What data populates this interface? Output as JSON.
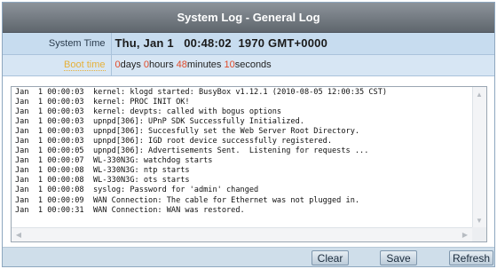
{
  "window": {
    "title": "System Log - General Log"
  },
  "system_time": {
    "label": "System Time",
    "value": "Thu, Jan 1   00:48:02  1970 GMT+0000"
  },
  "boot_time": {
    "label": "Boot time",
    "days": "0",
    "days_unit": "days ",
    "hours": "0",
    "hours_unit": "hours ",
    "minutes": "48",
    "minutes_unit": "minutes ",
    "seconds": "10",
    "seconds_unit": "seconds"
  },
  "log": {
    "lines": [
      "Jan  1 00:00:03  kernel: klogd started: BusyBox v1.12.1 (2010-08-05 12:00:35 CST)",
      "Jan  1 00:00:03  kernel: PROC INIT OK!",
      "Jan  1 00:00:03  kernel: devpts: called with bogus options",
      "Jan  1 00:00:03  upnpd[306]: UPnP SDK Successfully Initialized.",
      "Jan  1 00:00:03  upnpd[306]: Succesfully set the Web Server Root Directory.",
      "Jan  1 00:00:03  upnpd[306]: IGD root device successfully registered.",
      "Jan  1 00:00:05  upnpd[306]: Advertisements Sent.  Listening for requests ...",
      "Jan  1 00:00:07  WL-330N3G: watchdog starts",
      "Jan  1 00:00:08  WL-330N3G: ntp starts",
      "Jan  1 00:00:08  WL-330N3G: ots starts",
      "Jan  1 00:00:08  syslog: Password for 'admin' changed",
      "Jan  1 00:00:09  WAN Connection: The cable for Ethernet was not plugged in.",
      "Jan  1 00:00:31  WAN Connection: WAN was restored."
    ]
  },
  "buttons": {
    "clear": "Clear",
    "save": "Save",
    "refresh": "Refresh"
  }
}
